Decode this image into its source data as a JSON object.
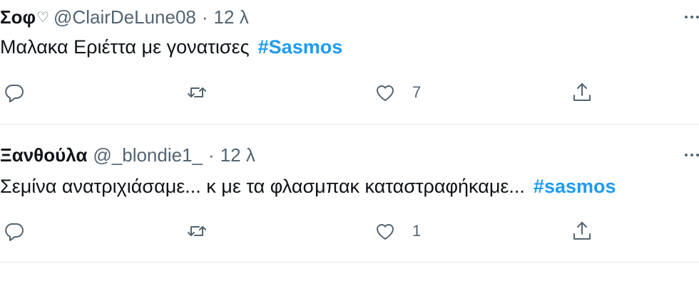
{
  "tweets": [
    {
      "display_name": "Σοφ",
      "name_emoji": "♡",
      "handle": "@ClairDeLune08",
      "separator": "·",
      "time": "12 λ",
      "text": "Μαλακα Εριέττα με γονατισες",
      "hashtag": "#Sasmos",
      "like_count": "7"
    },
    {
      "display_name": "Ξανθούλα",
      "handle": "@_blondie1_",
      "separator": "·",
      "time": "12 λ",
      "text": "Σεμίνα ανατριχιάσαμε... κ με τα φλασμπακ καταστραφήκαμε...",
      "hashtag": "#sasmos",
      "like_count": "1"
    }
  ],
  "icons": {
    "reply": "reply-icon",
    "retweet": "retweet-icon",
    "like": "heart-icon",
    "share": "share-icon",
    "more": "more-icon"
  },
  "colors": {
    "primary_text": "#0f1419",
    "secondary_text": "#536471",
    "hashtag": "#1d9bf0",
    "divider": "#eff3f4"
  }
}
